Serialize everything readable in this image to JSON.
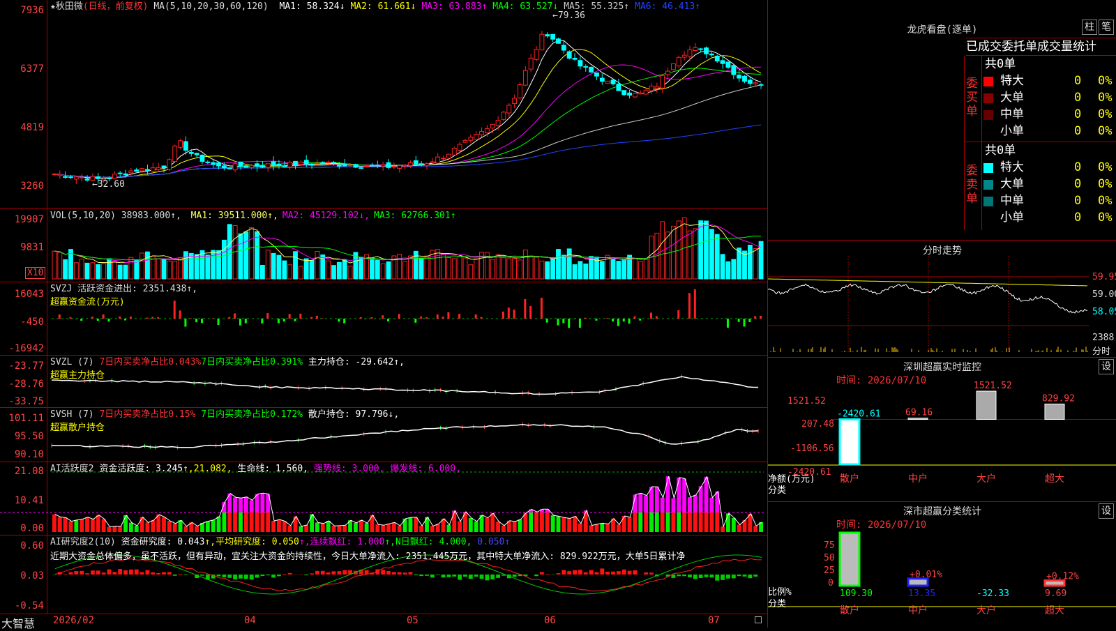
{
  "stock": {
    "name": "秋田微",
    "mode": "(日线，前复权)"
  },
  "main": {
    "ma_label": "MA(5,10,20,30,60,120)",
    "ma": [
      {
        "label": "MA1:",
        "value": "58.324",
        "arrow": "↓",
        "color": "#ffffff"
      },
      {
        "label": "MA2:",
        "value": "61.661",
        "arrow": "↓",
        "color": "#ffff00"
      },
      {
        "label": "MA3:",
        "value": "63.883",
        "arrow": "↑",
        "color": "#ff00ff"
      },
      {
        "label": "MA4:",
        "value": "63.527",
        "arrow": "↓",
        "color": "#00ff00"
      },
      {
        "label": "MA5:",
        "value": "55.325",
        "arrow": "↑",
        "color": "#cccccc"
      },
      {
        "label": "MA6:",
        "value": "46.413",
        "arrow": "↑",
        "color": "#2244ff"
      }
    ],
    "y_labels": [
      "7936",
      "6377",
      "4819",
      "3260"
    ],
    "high_label": "79.36",
    "low_label": "32.60"
  },
  "vol": {
    "label": "VOL(5,10,20)",
    "value": "38983.000↑,",
    "ma": [
      {
        "label": "MA1:",
        "value": "39511.000↑,",
        "color": "#ffff66"
      },
      {
        "label": "MA2:",
        "value": "45129.102↓,",
        "color": "#ff00ff"
      },
      {
        "label": "MA3:",
        "value": "62766.301↑",
        "color": "#00ff00"
      }
    ],
    "y_labels": [
      "19907",
      "9831"
    ],
    "unit": "X10"
  },
  "svzj": {
    "header": "SVZJ  活跃资金进出: 2351.438↑,",
    "sub": "超赢资金流(万元)",
    "y_labels": [
      "16043",
      "-450",
      "-16942"
    ]
  },
  "svzl": {
    "label": "SVZL (7)",
    "p1": "7日内买卖净占比0.043%",
    "p2": "7日内买卖净占比0.391%",
    "p3": "主力持仓: -29.642↑,",
    "sub": "超赢主力持仓",
    "y_labels": [
      "-23.77",
      "-28.76",
      "-33.75"
    ]
  },
  "svsh": {
    "label": "SVSH (7)",
    "p1": "7日内买卖净占比0.15%",
    "p2": "7日内买卖净占比0.172%",
    "p3": "散户持仓: 97.796↓,",
    "sub": "超赢散户持仓",
    "y_labels": [
      "101.11",
      "95.50",
      "90.10"
    ]
  },
  "ai2": {
    "label": "AI活跃度2",
    "p1": "资金活跃度: 3.245",
    "p2": "↑,21.082,",
    "p3": "生命线: 1.560,",
    "p4": "强势线: 3.000,",
    "p5": "爆发线: 6.000,",
    "y_labels": [
      "21.08",
      "10.41",
      "0.00"
    ]
  },
  "ai_r": {
    "label": "AI研究度2(10)",
    "p1": "资金研究度: 0.043",
    "p2": "↑,平均研究度: 0.050",
    "p3": "↑,连续飘红: 1.000",
    "p4": "↑,N日飘红: 4.000,",
    "p5": "0.050↑",
    "desc": "近期大资金总体偏多，虽不活跃，但有异动，宜关注大资金的持续性，今日大单净流入: 2351.445万元，其中特大单净流入: 829.922万元，大单5日累计净",
    "y_labels": [
      "0.60",
      "0.03",
      "-0.54"
    ]
  },
  "xaxis": {
    "brand": "大智慧",
    "labels": [
      "2026/02",
      "04",
      "05",
      "06",
      "07"
    ]
  },
  "lhb": {
    "title": "龙虎看盘(逐单)",
    "btn1": "柱",
    "btn2": "笔",
    "header": "已成交委托单成交量统计",
    "buy_label": "委买单",
    "sell_label": "委卖单",
    "buy_total": "共0单",
    "sell_total": "共0单",
    "buy_rows": [
      {
        "name": "特大",
        "count": "0",
        "pct": "0%",
        "color": "#ff0000"
      },
      {
        "name": "大单",
        "count": "0",
        "pct": "0%",
        "color": "#880000"
      },
      {
        "name": "中单",
        "count": "0",
        "pct": "0%",
        "color": "#660000"
      },
      {
        "name": "小单",
        "count": "0",
        "pct": "0%",
        "color": "#000000"
      }
    ],
    "sell_rows": [
      {
        "name": "特大",
        "count": "0",
        "pct": "0%",
        "color": "#00ffff"
      },
      {
        "name": "大单",
        "count": "0",
        "pct": "0%",
        "color": "#008888"
      },
      {
        "name": "中单",
        "count": "0",
        "pct": "0%",
        "color": "#007777"
      },
      {
        "name": "小单",
        "count": "0",
        "pct": "0%",
        "color": "#000000"
      }
    ]
  },
  "fenshi": {
    "title": "分时走势",
    "y_labels": [
      "59.95",
      "59.00",
      "58.05"
    ],
    "vol_label": "2388",
    "footer": "分时"
  },
  "monitor": {
    "title": "深圳超赢实时监控",
    "btn": "设",
    "time": "时间: 2026/07/10",
    "y_labels": [
      "1521.52",
      "207.48",
      "-1106.56",
      "-2420.61"
    ],
    "unit": "净额(万元)",
    "cat_label": "分类",
    "values": [
      {
        "name": "散户",
        "value": "-2420.61",
        "num": -2420.61
      },
      {
        "name": "中户",
        "value": "69.16",
        "num": 69.16
      },
      {
        "name": "大户",
        "value": "1521.52",
        "num": 1521.52
      },
      {
        "name": "超大",
        "value": "829.92",
        "num": 829.92
      }
    ]
  },
  "classify": {
    "title": "深市超赢分类统计",
    "btn": "设",
    "time": "时间: 2026/07/10",
    "y_labels": [
      "75",
      "50",
      "25",
      "0"
    ],
    "unit": "比例%",
    "cat_label": "分类",
    "items": [
      {
        "name": "散户",
        "value": "109.30",
        "label": "",
        "num": 109.3
      },
      {
        "name": "中户",
        "value": "13.35",
        "label": "+0.01%",
        "num": 13.35
      },
      {
        "name": "大户",
        "value": "-32.33",
        "label": "",
        "num": -32.33
      },
      {
        "name": "超大",
        "value": "9.69",
        "label": "+0.12%",
        "num": 9.69
      }
    ]
  }
}
